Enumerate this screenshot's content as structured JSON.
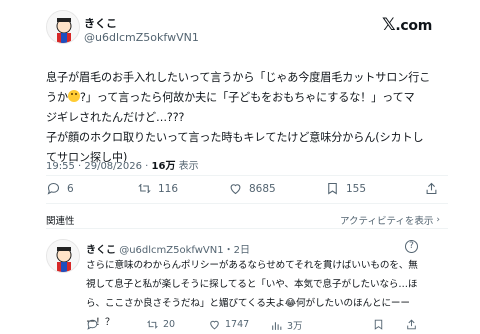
{
  "tweet": {
    "author_name": "きくこ",
    "author_handle": "@u6dlcmZ5okfwVN1",
    "brand": "X.com",
    "lines": [
      "息子が眉毛のお手入れしたいって言うから「じゃあ今度眉毛カットサロン行こ",
      "?」って言ったら何故か夫に「子どもをおもちゃにするな！」ってマ",
      "ジギレされたんだけど…???",
      "子が顔のホクロ取りたいって言った時もキレてたけど意味分からん(シカトし",
      "てサロン探し中)"
    ],
    "line2_prefix": "うか",
    "time": "19:55 · 29/08/2026 · ",
    "views_count": "16万",
    "views_label": "表示",
    "replies": "6",
    "retweets": "116",
    "likes": "8685",
    "bookmarks": "155"
  },
  "related_label": "関連性",
  "activity_label": "アクティビティを表示",
  "reply": {
    "author_name": "きくこ",
    "author_handle": "@u6dlcmZ5okfwVN1・2日",
    "lines": [
      "さらに意味のわからんポリシーがあるならせめてそれを貫けばいいものを、無",
      "視して息子と私が楽しそうに探してると「いや、本気で息子がしたいなら…ほ",
      "ら、ここさか良さそうだね」と媚びてくる夫よ😂何がしたいのほんとにーー",
      "ー！？"
    ],
    "replies": "",
    "retweets": "20",
    "likes": "1747",
    "views": "3万"
  },
  "colors": {
    "text": "#0f1419",
    "muted": "#536471",
    "divider": "#eff3f4"
  },
  "icons": [
    "avatar",
    "x-logo-icon",
    "reply-icon",
    "retweet-icon",
    "like-icon",
    "bookmark-icon",
    "share-icon",
    "views-icon",
    "help-icon",
    "chevron-right-icon"
  ]
}
